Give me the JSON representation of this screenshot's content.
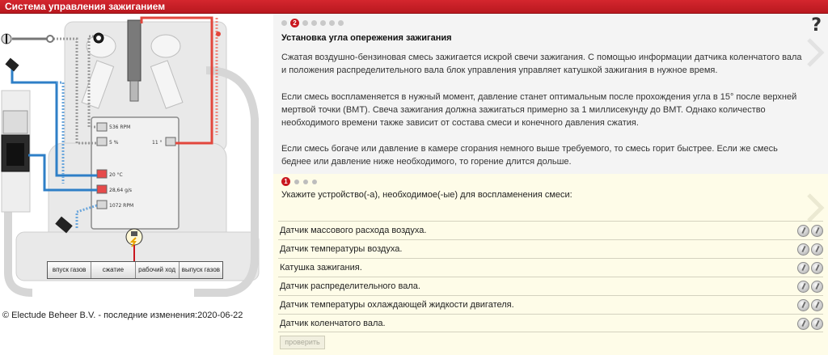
{
  "window": {
    "title": "Система управления зажиганием"
  },
  "diagram": {
    "readouts": {
      "rpm_top": "536 RPM",
      "percent": "5 %",
      "angle": "11 °",
      "temp": "20 °C",
      "flow": "28,64 g/s",
      "rpm_bottom": "1072 RPM"
    },
    "phases": [
      "впуск газов",
      "сжатие",
      "рабочий ход",
      "выпуск газов"
    ],
    "colors": {
      "wire_blue": "#2e7fc7",
      "wire_red": "#e2473d",
      "wire_grey": "#888888",
      "accent": "#c9171f"
    }
  },
  "footer": {
    "copyright": "© Electude Beheer B.V. - последние изменения:2020-06-22"
  },
  "content": {
    "page_indicator": {
      "current": "2",
      "total_dots": 7
    },
    "title": "Установка угла опережения зажигания",
    "paragraphs": [
      "Сжатая воздушно-бензиновая смесь зажигается искрой свечи зажигания. С помощью информации датчика коленчатого вала и положения распределительного вала блок управления управляет катушкой зажигания в нужное время.",
      "Если смесь воспламеняется в нужный момент, давление станет оптимальным после прохождения угла в 15° после верхней мертвой точки (ВМТ). Свеча зажигания должна зажигаться примерно за 1 миллисекунду до ВМТ. Однако количество необходимого времени также зависит от состава смеси и конечного давления сжатия.",
      "Если смесь богаче или давление в камере сгорания немного выше требуемого, то смесь горит быстрее. Если же смесь беднее или давление ниже необходимого, то горение длится дольше."
    ],
    "help_icon": "?"
  },
  "quiz": {
    "indicator": {
      "current": "1",
      "total_dots": 4
    },
    "question": "Укажите устройство(-а), необходимое(-ые) для воспламенения смеси:",
    "options": [
      "Датчик массового расхода воздуха.",
      "Датчик температуры воздуха.",
      "Катушка зажигания.",
      "Датчик распределительного вала.",
      "Датчик температуры охлаждающей жидкости двигателя.",
      "Датчик коленчатого вала."
    ],
    "check_label": "проверить"
  }
}
